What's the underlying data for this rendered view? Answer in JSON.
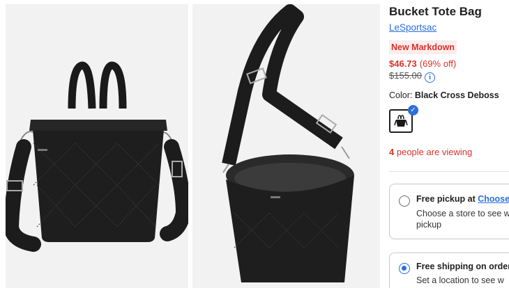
{
  "product": {
    "title": "Bucket Tote Bag",
    "brand": "LeSportsac",
    "badge": "New Markdown",
    "price": "$46.73",
    "discount": "(69% off)",
    "original_price": "$155.00",
    "color_label": "Color:",
    "color_name": "Black Cross Deboss",
    "viewing_count": "4",
    "viewing_text": "people are viewing"
  },
  "fulfillment": {
    "pickup_title": "Free pickup at",
    "pickup_link": "Choose s",
    "pickup_sub": "Choose a store to see w pickup",
    "shipping_title": "Free shipping on orders",
    "shipping_sub": "Set a location to see w"
  },
  "icons": {
    "info": "info-icon",
    "check": "checkmark-icon"
  },
  "colors": {
    "sale_red": "#d8322a",
    "link_blue": "#2a6fdc",
    "badge_bg": "#fdeded"
  }
}
